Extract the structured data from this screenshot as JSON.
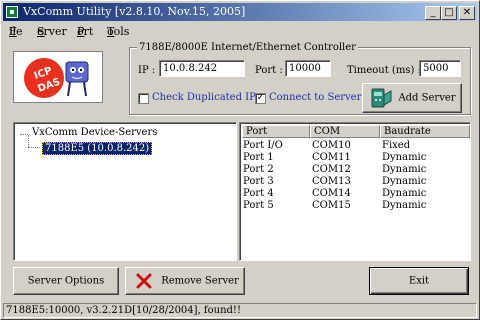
{
  "window": {
    "title": "VxComm Utility [v2.8.10, Nov.15, 2005]",
    "minimize_glyph": "_",
    "maximize_glyph": "□",
    "close_glyph": "✕"
  },
  "menu": {
    "items": [
      {
        "first": "F",
        "rest": "ile"
      },
      {
        "first": "S",
        "rest": "erver"
      },
      {
        "first": "P",
        "rest": "ort"
      },
      {
        "first": "T",
        "rest": "ools"
      }
    ]
  },
  "logo": {
    "text": "ICP DAS"
  },
  "controller": {
    "group_title": "7188E/8000E Internet/Ethernet Controller",
    "ip_label": "IP :",
    "ip_value": "10.0.8.242",
    "port_label": "Port :",
    "port_value": "10000",
    "timeout_label": "Timeout (ms) :",
    "timeout_value": "5000",
    "check_duplicated_label": "Check Duplicated IP",
    "check_duplicated_checked": false,
    "connect_label": "Connect to Server",
    "connect_checked": true,
    "add_server_label": "Add Server"
  },
  "tree": {
    "root_label": "VxComm Device-Servers",
    "selected_label": "7188E5 (10.0.8.242)"
  },
  "ports_table": {
    "headers": [
      "Port",
      "COM",
      "Baudrate"
    ],
    "rows": [
      [
        "Port I/O",
        "COM10",
        "Fixed"
      ],
      [
        "Port 1",
        "COM11",
        "Dynamic"
      ],
      [
        "Port 2",
        "COM12",
        "Dynamic"
      ],
      [
        "Port 3",
        "COM13",
        "Dynamic"
      ],
      [
        "Port 4",
        "COM14",
        "Dynamic"
      ],
      [
        "Port 5",
        "COM15",
        "Dynamic"
      ]
    ]
  },
  "buttons": {
    "server_options": "Server Options",
    "remove_server": "Remove Server",
    "exit": "Exit"
  },
  "status_bar": "7188E5:10000, v3.2.21D[10/28/2004], found!!",
  "colors": {
    "title_bar": "#0a246a",
    "selection": "#0a246a",
    "checkbox_label": "#1a2fb0",
    "remove_icon": "#d01010"
  }
}
